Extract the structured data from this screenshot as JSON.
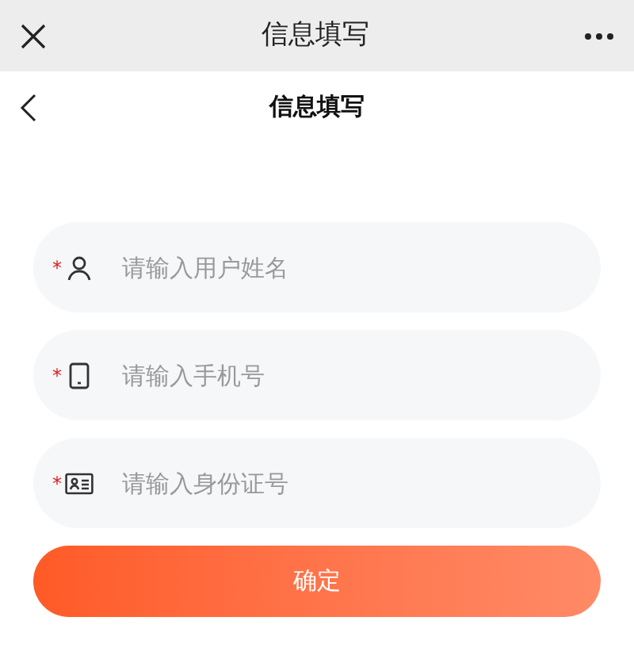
{
  "window": {
    "title": "信息填写"
  },
  "header": {
    "title": "信息填写"
  },
  "fields": [
    {
      "kind": "person",
      "required_mark": "*",
      "placeholder": "请输入用户姓名"
    },
    {
      "kind": "phone",
      "required_mark": "*",
      "placeholder": "请输入手机号"
    },
    {
      "kind": "idcard",
      "required_mark": "*",
      "placeholder": "请输入身份证号"
    }
  ],
  "submit": {
    "label": "确定"
  }
}
